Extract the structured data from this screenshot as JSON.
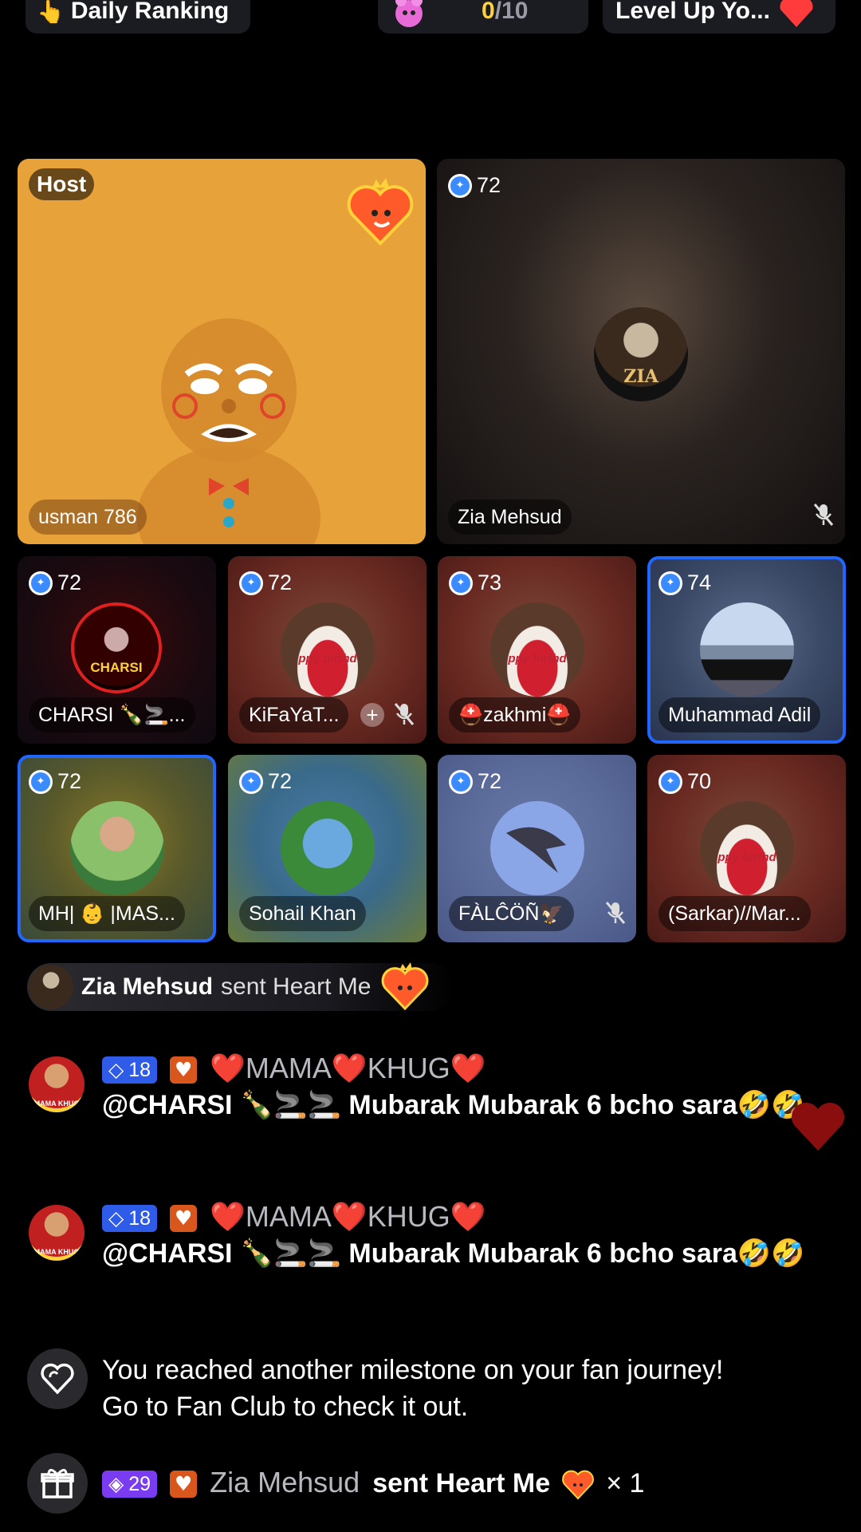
{
  "top_bar": {
    "daily_ranking": "Daily Ranking",
    "daily_ranking_emoji": "👆",
    "counter_current": "0",
    "counter_total": "/10",
    "level_up": "Level Up Yo..."
  },
  "host_seat": {
    "role_label": "Host",
    "name": "usman 786"
  },
  "big_seat": {
    "level": "72",
    "name": "Zia Mehsud",
    "avatar_text": "ZIA"
  },
  "seats_row1": [
    {
      "level": "72",
      "name": "CHARSI 🍾🚬..."
    },
    {
      "level": "72",
      "name": "KiFaYaT..."
    },
    {
      "level": "73",
      "name": "⛑️zakhmi⛑️"
    },
    {
      "level": "74",
      "name": "Muhammad Adil"
    }
  ],
  "seats_row2": [
    {
      "level": "72",
      "name": "MH| 👶 |MAS..."
    },
    {
      "level": "72",
      "name": "Sohail Khan"
    },
    {
      "level": "72",
      "name": "FÀLĈÖÑ🦅"
    },
    {
      "level": "70",
      "name": "(Sarkar)//Mar..."
    }
  ],
  "charsi_avatar_text": "CHARSI",
  "cake_text": "ppy birthd",
  "gift_notice": {
    "user": "Zia Mehsud",
    "action": "sent Heart Me"
  },
  "chat_messages": [
    {
      "level": "18",
      "username": "❤️MAMA❤️KHUG❤️",
      "message": "@CHARSI 🍾🚬🚬 Mubarak Mubarak 6 bcho sara🤣🤣",
      "avatar_text": "MAMA KHUG"
    },
    {
      "level": "18",
      "username": "❤️MAMA❤️KHUG❤️",
      "message": "@CHARSI 🍾🚬🚬 Mubarak Mubarak 6 bcho sara🤣🤣",
      "avatar_text": "MAMA KHUG"
    }
  ],
  "milestone": {
    "line1": "You reached another milestone on your fan journey!",
    "line2": "Go to Fan Club to check it out."
  },
  "gift_message": {
    "level": "29",
    "user": "Zia Mehsud",
    "action": "sent Heart Me",
    "count": "× 1"
  },
  "colors": {
    "accent_blue": "#2167ff",
    "counter_yellow": "#ffd23c",
    "host_bg": "#e8a23a"
  }
}
